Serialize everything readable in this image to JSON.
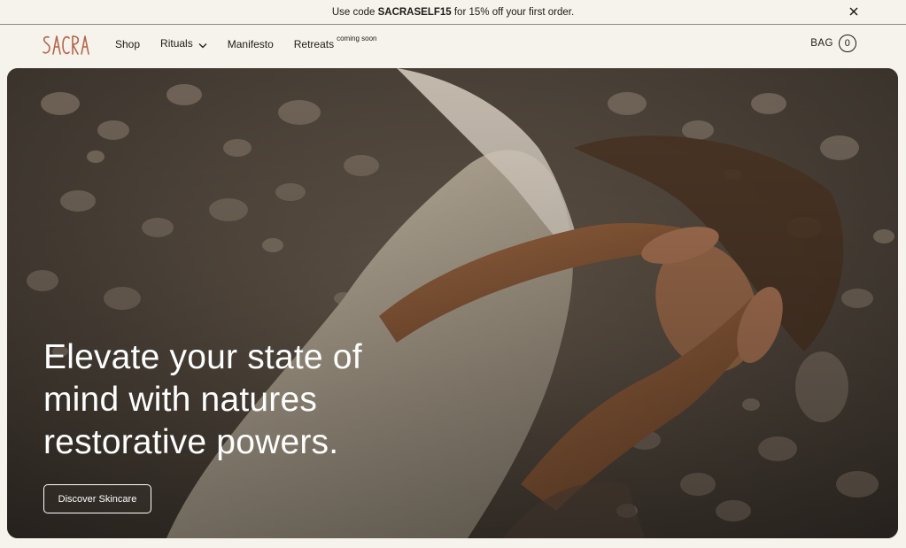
{
  "announcement": {
    "prefix": "Use code ",
    "code": "SACRASELF15",
    "suffix": " for 15% off your first order."
  },
  "header": {
    "logo_text": "SACRA",
    "nav": [
      {
        "label": "Shop"
      },
      {
        "label": "Rituals"
      },
      {
        "label": "Manifesto"
      },
      {
        "label": "Retreats",
        "badge": "coming soon"
      }
    ],
    "bag_label": "BAG",
    "bag_count": "0"
  },
  "hero": {
    "title": "Elevate your state of mind with natures restorative powers.",
    "cta_label": "Discover Skincare"
  },
  "colors": {
    "background": "#f6f3ec",
    "logo": "#b5654a",
    "text": "#1c1a17"
  },
  "icons": {
    "close": "close-icon",
    "chevron": "chevron-down-icon"
  }
}
